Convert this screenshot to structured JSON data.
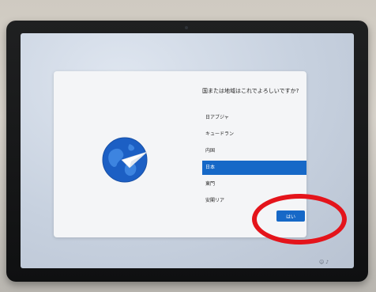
{
  "oobe": {
    "title": "国または地域はこれでよろしいですか?",
    "regions": [
      {
        "label": "日アブジャ",
        "selected": false
      },
      {
        "label": "キュードラン",
        "selected": false
      },
      {
        "label": "内国",
        "selected": false
      },
      {
        "label": "日本",
        "selected": true
      },
      {
        "label": "東門",
        "selected": false
      },
      {
        "label": "安閣リア",
        "selected": false
      }
    ],
    "yes_button_label": "はい"
  },
  "colors": {
    "accent": "#1668c7",
    "annotation": "#e4141b"
  },
  "icons": {
    "globe": "globe-with-paper-plane-icon"
  }
}
